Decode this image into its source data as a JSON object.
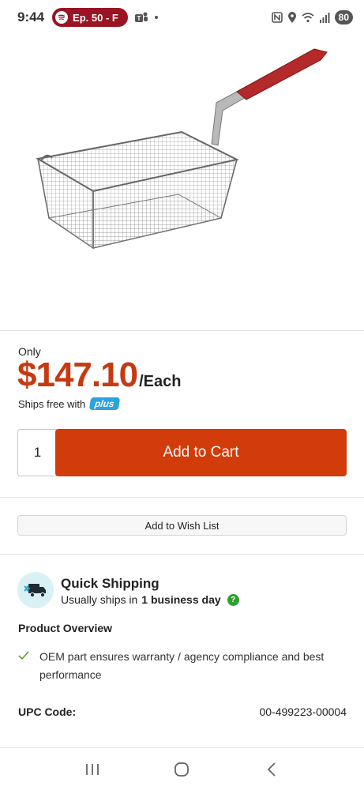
{
  "status_bar": {
    "time": "9:44",
    "media_pill": "Ep. 50 - F",
    "battery": "80"
  },
  "product": {
    "price_prefix": "Only",
    "price": "$147.10",
    "price_unit": "/Each",
    "ships_free_text": "Ships free with",
    "plus_badge": "plus"
  },
  "cart": {
    "quantity": "1",
    "add_to_cart_label": "Add to Cart",
    "wish_list_label": "Add to Wish List"
  },
  "shipping": {
    "title": "Quick Shipping",
    "subtitle_prefix": "Usually ships in",
    "subtitle_bold": "1 business day",
    "help_icon": "?"
  },
  "overview": {
    "title": "Product Overview",
    "items": [
      "OEM part ensures warranty / agency compliance and best performance"
    ]
  },
  "specs": {
    "upc_label": "UPC Code:",
    "upc_value": "00-499223-00004"
  },
  "colors": {
    "price": "#c63a11",
    "cart_button": "#d23b0a",
    "plus_badge": "#2ba3e0",
    "check": "#5aa02c"
  },
  "icons": {
    "ship": "delivery-truck-icon",
    "check": "checkmark-icon",
    "help": "question-icon"
  }
}
